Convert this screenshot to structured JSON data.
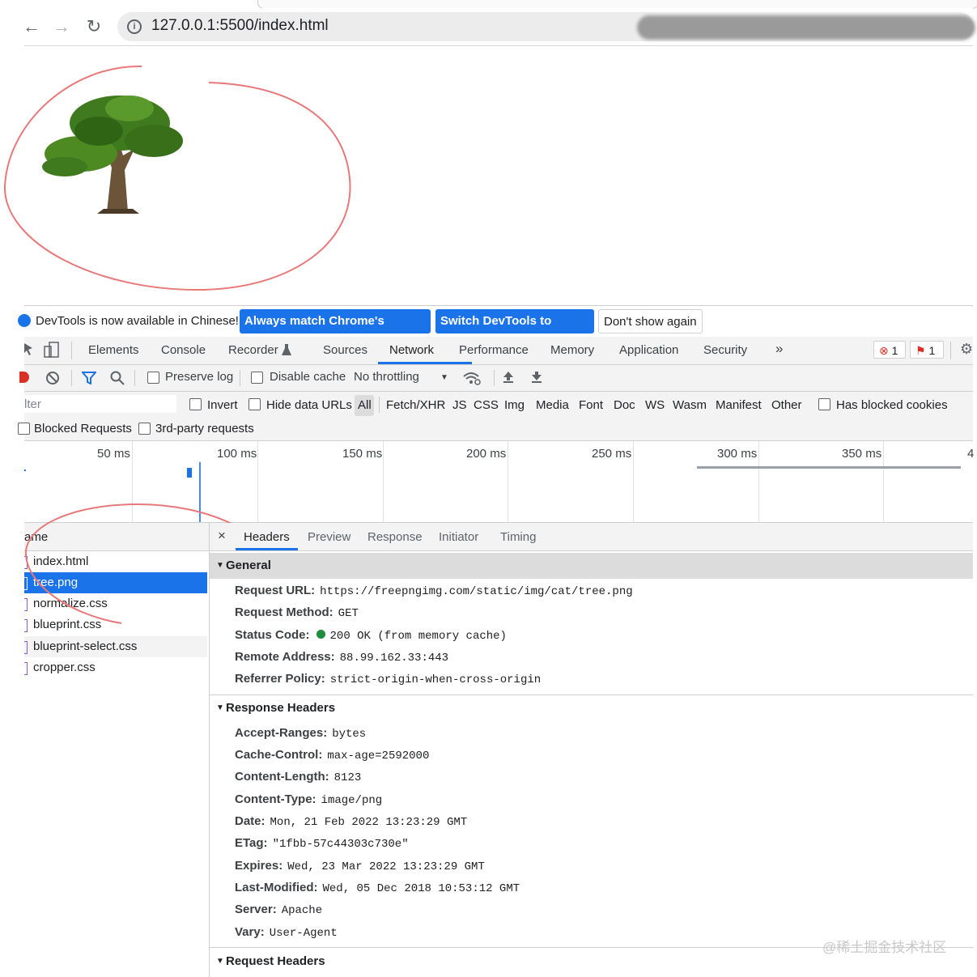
{
  "browser": {
    "url": "127.0.0.1:5500/index.html",
    "back": "←",
    "forward": "→",
    "reload": "↻"
  },
  "infobar": {
    "message": "DevTools is now available in Chinese!",
    "always_match": "Always match Chrome's language",
    "switch": "Switch DevTools to Chinese",
    "dont_show": "Don't show again"
  },
  "main_tabs": [
    "Elements",
    "Console",
    "Recorder",
    "Sources",
    "Network",
    "Performance",
    "Memory",
    "Application",
    "Security"
  ],
  "more_tabs": "»",
  "badges": {
    "errors": "1",
    "issues": "1"
  },
  "toolbar": {
    "preserve_log": "Preserve log",
    "disable_cache": "Disable cache",
    "throttling": "No throttling",
    "throttling_caret": "▼"
  },
  "filter": {
    "placeholder": "lter",
    "invert": "Invert",
    "hide_data_urls": "Hide data URLs",
    "types": [
      "All",
      "Fetch/XHR",
      "JS",
      "CSS",
      "Img",
      "Media",
      "Font",
      "Doc",
      "WS",
      "Wasm",
      "Manifest",
      "Other"
    ],
    "has_blocked_cookies": "Has blocked cookies",
    "blocked_requests": "Blocked Requests",
    "third_party": "3rd-party requests"
  },
  "timeline": {
    "ticks": [
      "50 ms",
      "100 ms",
      "150 ms",
      "200 ms",
      "250 ms",
      "300 ms",
      "350 ms",
      "4"
    ]
  },
  "requests": {
    "header": "ame",
    "rows": [
      "index.html",
      "tree.png",
      "normalize.css",
      "blueprint.css",
      "blueprint-select.css",
      "cropper.css"
    ],
    "selected": "tree.png"
  },
  "detail": {
    "close": "×",
    "tabs": [
      "Headers",
      "Preview",
      "Response",
      "Initiator",
      "Timing"
    ],
    "general": {
      "title": "General",
      "request_url_k": "Request URL:",
      "request_url_v": "https://freepngimg.com/static/img/cat/tree.png",
      "method_k": "Request Method:",
      "method_v": "GET",
      "status_k": "Status Code:",
      "status_v": "200 OK (from memory cache)",
      "remote_k": "Remote Address:",
      "remote_v": "88.99.162.33:443",
      "referrer_k": "Referrer Policy:",
      "referrer_v": "strict-origin-when-cross-origin"
    },
    "response_headers": {
      "title": "Response Headers",
      "items": [
        {
          "k": "Accept-Ranges:",
          "v": "bytes"
        },
        {
          "k": "Cache-Control:",
          "v": "max-age=2592000"
        },
        {
          "k": "Content-Length:",
          "v": "8123"
        },
        {
          "k": "Content-Type:",
          "v": "image/png"
        },
        {
          "k": "Date:",
          "v": "Mon, 21 Feb 2022 13:23:29 GMT"
        },
        {
          "k": "ETag:",
          "v": "\"1fbb-57c44303c730e\""
        },
        {
          "k": "Expires:",
          "v": "Wed, 23 Mar 2022 13:23:29 GMT"
        },
        {
          "k": "Last-Modified:",
          "v": "Wed, 05 Dec 2018 10:53:12 GMT"
        },
        {
          "k": "Server:",
          "v": "Apache"
        },
        {
          "k": "Vary:",
          "v": "User-Agent"
        }
      ]
    },
    "request_headers": {
      "title": "Request Headers"
    }
  },
  "colors": {
    "accent": "#1a73e8",
    "annotation": "#e8787a",
    "selected_row": "#1a73e8"
  },
  "watermark": "@稀土掘金技术社区"
}
